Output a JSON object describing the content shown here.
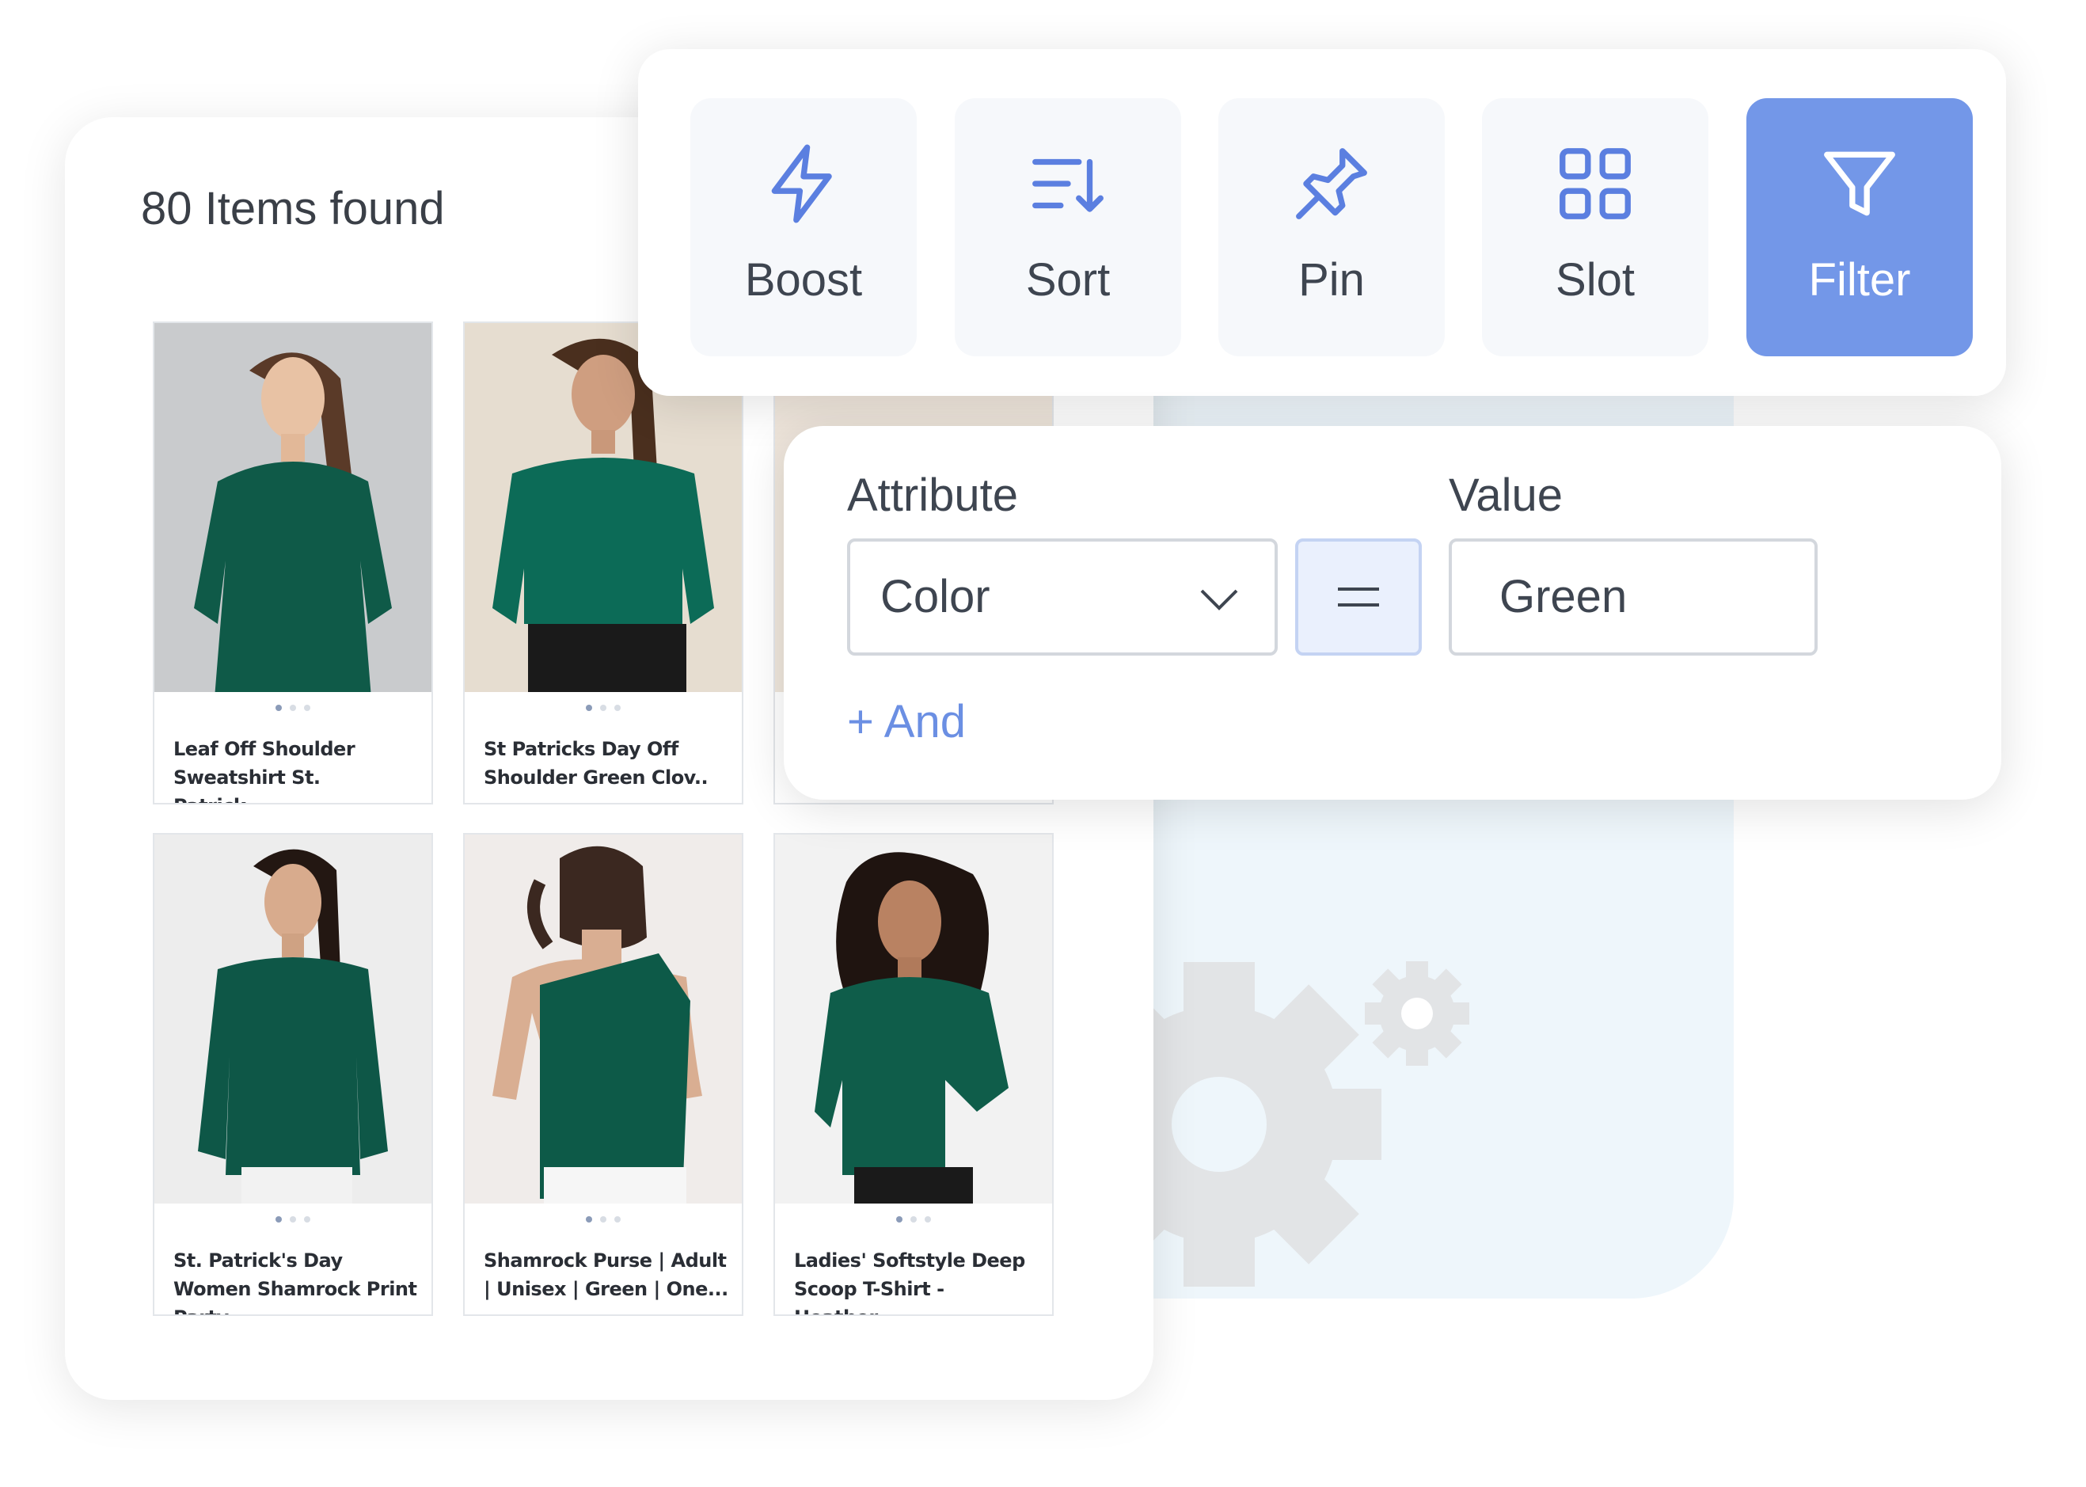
{
  "results": {
    "count_label": "80 Items found"
  },
  "products": [
    {
      "title": "Leaf Off Shoulder Sweatshirt St. Patrick..."
    },
    {
      "title": "St Patricks Day Off Shoulder Green Clov.."
    },
    {
      "title": ""
    },
    {
      "title": "St. Patrick's Day Women Shamrock Print Party.."
    },
    {
      "title": "Shamrock Purse | Adult | Unisex | Green | One..."
    },
    {
      "title": "Ladies' Softstyle Deep Scoop T-Shirt - Heather.."
    }
  ],
  "toolbar": {
    "items": [
      {
        "label": "Boost",
        "icon": "lightning-icon"
      },
      {
        "label": "Sort",
        "icon": "sort-icon"
      },
      {
        "label": "Pin",
        "icon": "pin-icon"
      },
      {
        "label": "Slot",
        "icon": "grid-icon"
      },
      {
        "label": "Filter",
        "icon": "filter-icon",
        "active": true
      }
    ],
    "accent": "#7397e8",
    "icon_color": "#5b7fe0"
  },
  "filter": {
    "attribute_label": "Attribute",
    "value_label": "Value",
    "attribute_value": "Color",
    "operator": "=",
    "value": "Green",
    "and_label": "+ And"
  },
  "colors": {
    "product_green": "#0f5a48",
    "background_panel": "#eef6fb"
  }
}
